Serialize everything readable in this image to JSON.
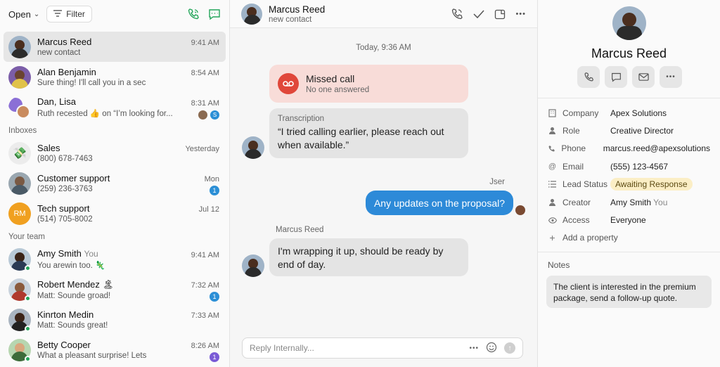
{
  "sidebar": {
    "open_label": "Open",
    "filter_label": "Filter",
    "conversations": [
      {
        "name": "Marcus Reed",
        "preview": "new contact",
        "time": "9:41 AM"
      },
      {
        "name": "Alan Benjamin",
        "preview": "Sure thing! I'll call you in a sec",
        "time": "8:54 AM"
      },
      {
        "name": "Dan, Lisa",
        "preview": "Ruth recested 👍 on “I’m looking for...",
        "time": "8:31 AM"
      }
    ],
    "inboxes_label": "Inboxes",
    "inboxes": [
      {
        "name": "Sales",
        "icon": "💸",
        "preview": "(800) 678-7463",
        "time": "Yesterday"
      },
      {
        "name": "Customer support",
        "preview": "(259) 236-3763",
        "time": "Mon",
        "badge": "1"
      },
      {
        "name": "Tech support",
        "initials": "RM",
        "preview": "(514) 705-8002",
        "time": "Jul 12"
      }
    ],
    "team_label": "Your team",
    "team": [
      {
        "name": "Amy Smith",
        "you": "You",
        "preview": "You arewin too. 🦎",
        "time": "9:41 AM"
      },
      {
        "name": "Robert Mendez 🏝",
        "preview": "Matt: Sounde groad!",
        "time": "7:32 AM",
        "badge": "1"
      },
      {
        "name": "Kinrton Medin",
        "preview": "Matt: Sounds great!",
        "time": "7:33 AM"
      },
      {
        "name": "Betty Cooper",
        "preview": "What a pleasant surprise! Lets",
        "time": "8:26 AM",
        "badge": "1"
      }
    ]
  },
  "chat": {
    "header": {
      "name": "Marcus Reed",
      "sub": "new contact"
    },
    "date": "Today, 9:36 AM",
    "missed_title": "Missed call",
    "missed_sub": "No one answered",
    "transcription_label": "Transcription",
    "transcription_text": "“I tried calling earlier, please reach out when available.”",
    "out_sender": "Jser",
    "out_text": "Any updates on the proposal?",
    "in_sender": "Marcus Reed",
    "in_text": "I'm wrapping it up, should be ready by end of day.",
    "composer_placeholder": "Reply Internally...",
    "more": "•••"
  },
  "contact": {
    "name": "Marcus Reed",
    "more": "•••",
    "properties": [
      {
        "label": "Company",
        "value": "Apex Solutions",
        "icon": "building-icon"
      },
      {
        "label": "Role",
        "value": "Creative Director",
        "icon": "person-icon"
      },
      {
        "label": "Phone",
        "value": "marcus.reed@apexsolutions",
        "icon": "phone-icon"
      },
      {
        "label": "Email",
        "value": "(555) 123-4567",
        "icon": "at-icon"
      },
      {
        "label": "Lead Status",
        "value": "Awaiting Response",
        "icon": "list-icon"
      },
      {
        "label": "Creator",
        "value": "Amy Smith",
        "you": "You",
        "icon": "person-icon"
      },
      {
        "label": "Access",
        "value": "Everyone",
        "icon": "eye-icon"
      }
    ],
    "add_property": "Add a property",
    "notes_label": "Notes",
    "note_text": "The client is interested in the premium package, send a follow-up quote."
  },
  "colors": {
    "accent_blue": "#2d8ad8",
    "green": "#23a55a",
    "missed_red": "#e0473a",
    "status_yellow": "#fbeec5"
  }
}
